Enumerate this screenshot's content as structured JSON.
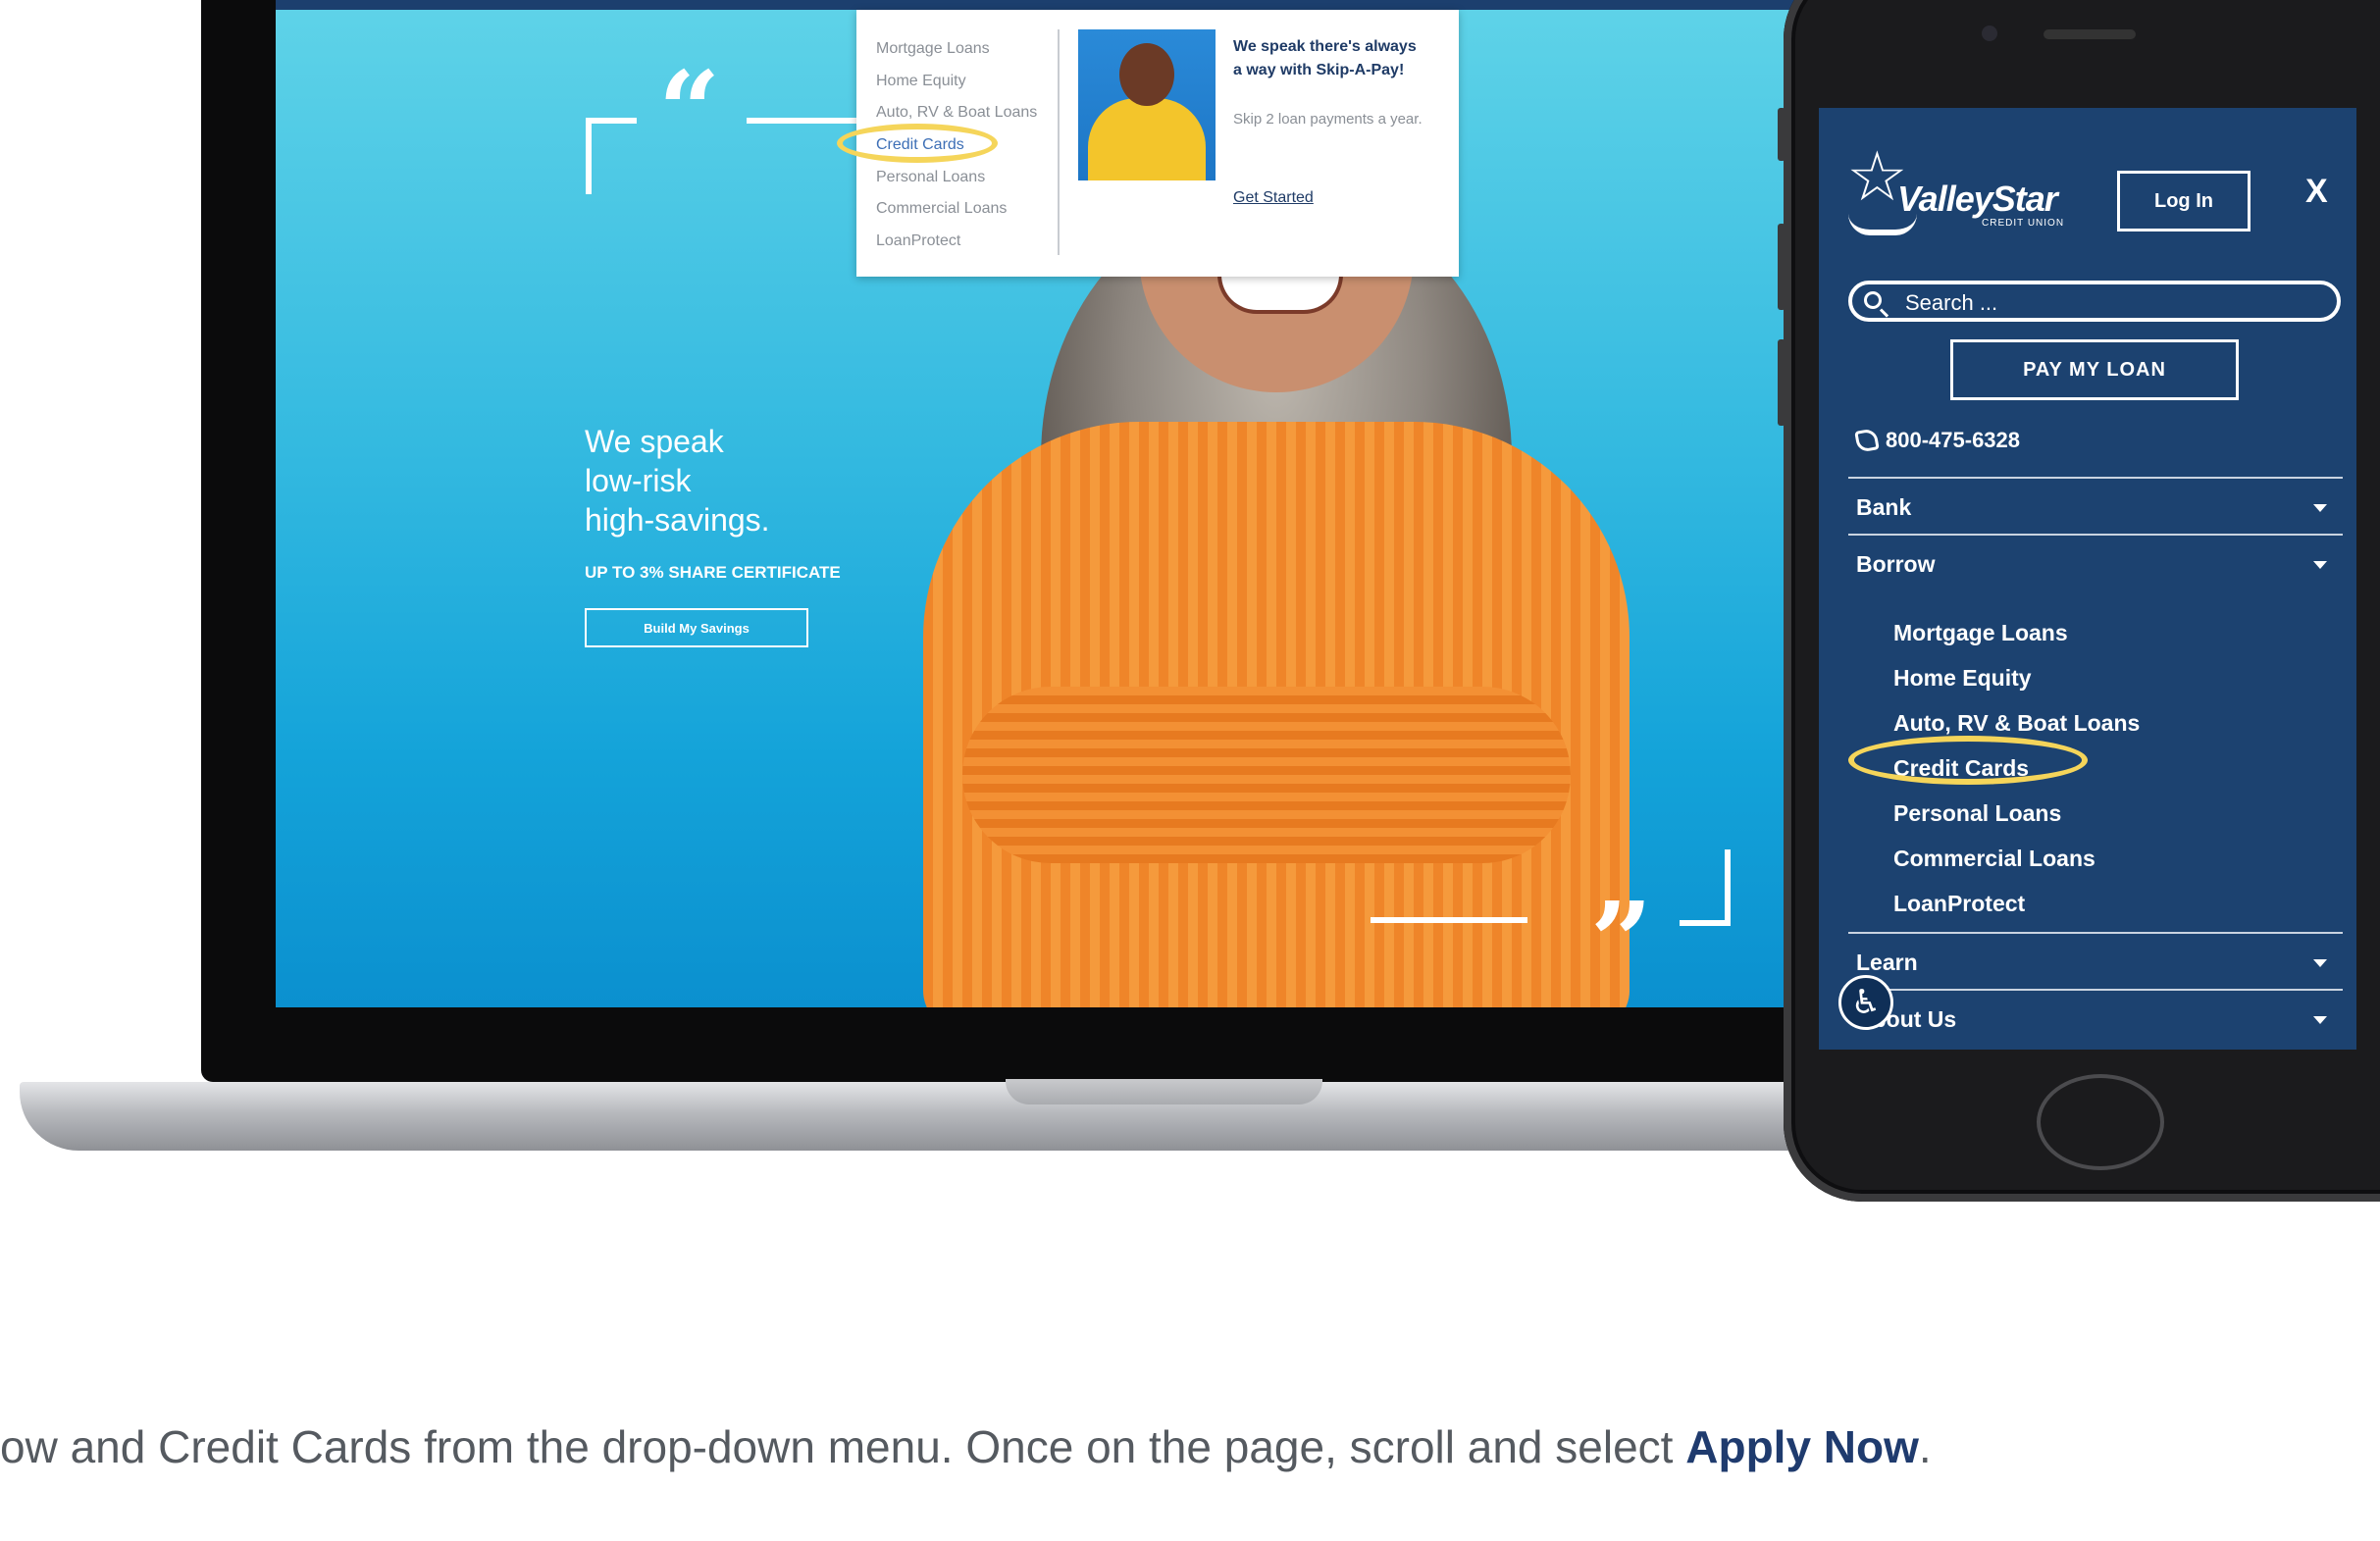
{
  "laptop": {
    "hero": {
      "headline_1": "We speak",
      "headline_2": "low-risk",
      "headline_3": "high-savings.",
      "subheading": "UP TO 3% SHARE CERTIFICATE",
      "button_label": "Build My Savings"
    },
    "mega_menu": {
      "items": [
        "Mortgage Loans",
        "Home Equity",
        "Auto, RV & Boat Loans",
        "Credit Cards",
        "Personal Loans",
        "Commercial Loans",
        "LoanProtect"
      ],
      "active_item": "Credit Cards",
      "promo_title": "We speak there's always a way with Skip-A-Pay!",
      "promo_text": "Skip 2 loan payments a year.",
      "promo_link": "Get Started"
    }
  },
  "phone": {
    "brand": "ValleyStar",
    "brand_sub": "CREDIT UNION",
    "login_label": "Log In",
    "close_label": "X",
    "search_placeholder": "Search ...",
    "pay_label": "PAY MY LOAN",
    "phone_number": "800-475-6328",
    "nav": {
      "bank": "Bank",
      "borrow": "Borrow",
      "learn": "Learn",
      "about": "About Us"
    },
    "borrow_items": [
      "Mortgage Loans",
      "Home Equity",
      "Auto, RV & Boat Loans",
      "Credit Cards",
      "Personal Loans",
      "Commercial Loans",
      "LoanProtect"
    ],
    "highlighted_item": "Credit Cards"
  },
  "caption": {
    "text": "ow and Credit Cards from the drop-down menu. Once on the page, scroll and select ",
    "link": "Apply Now",
    "end": "."
  },
  "colors": {
    "navy": "#1c4270",
    "highlight": "#f5d55a",
    "hero_cyan": "#33b9e0",
    "sweater_orange": "#ef8529"
  }
}
